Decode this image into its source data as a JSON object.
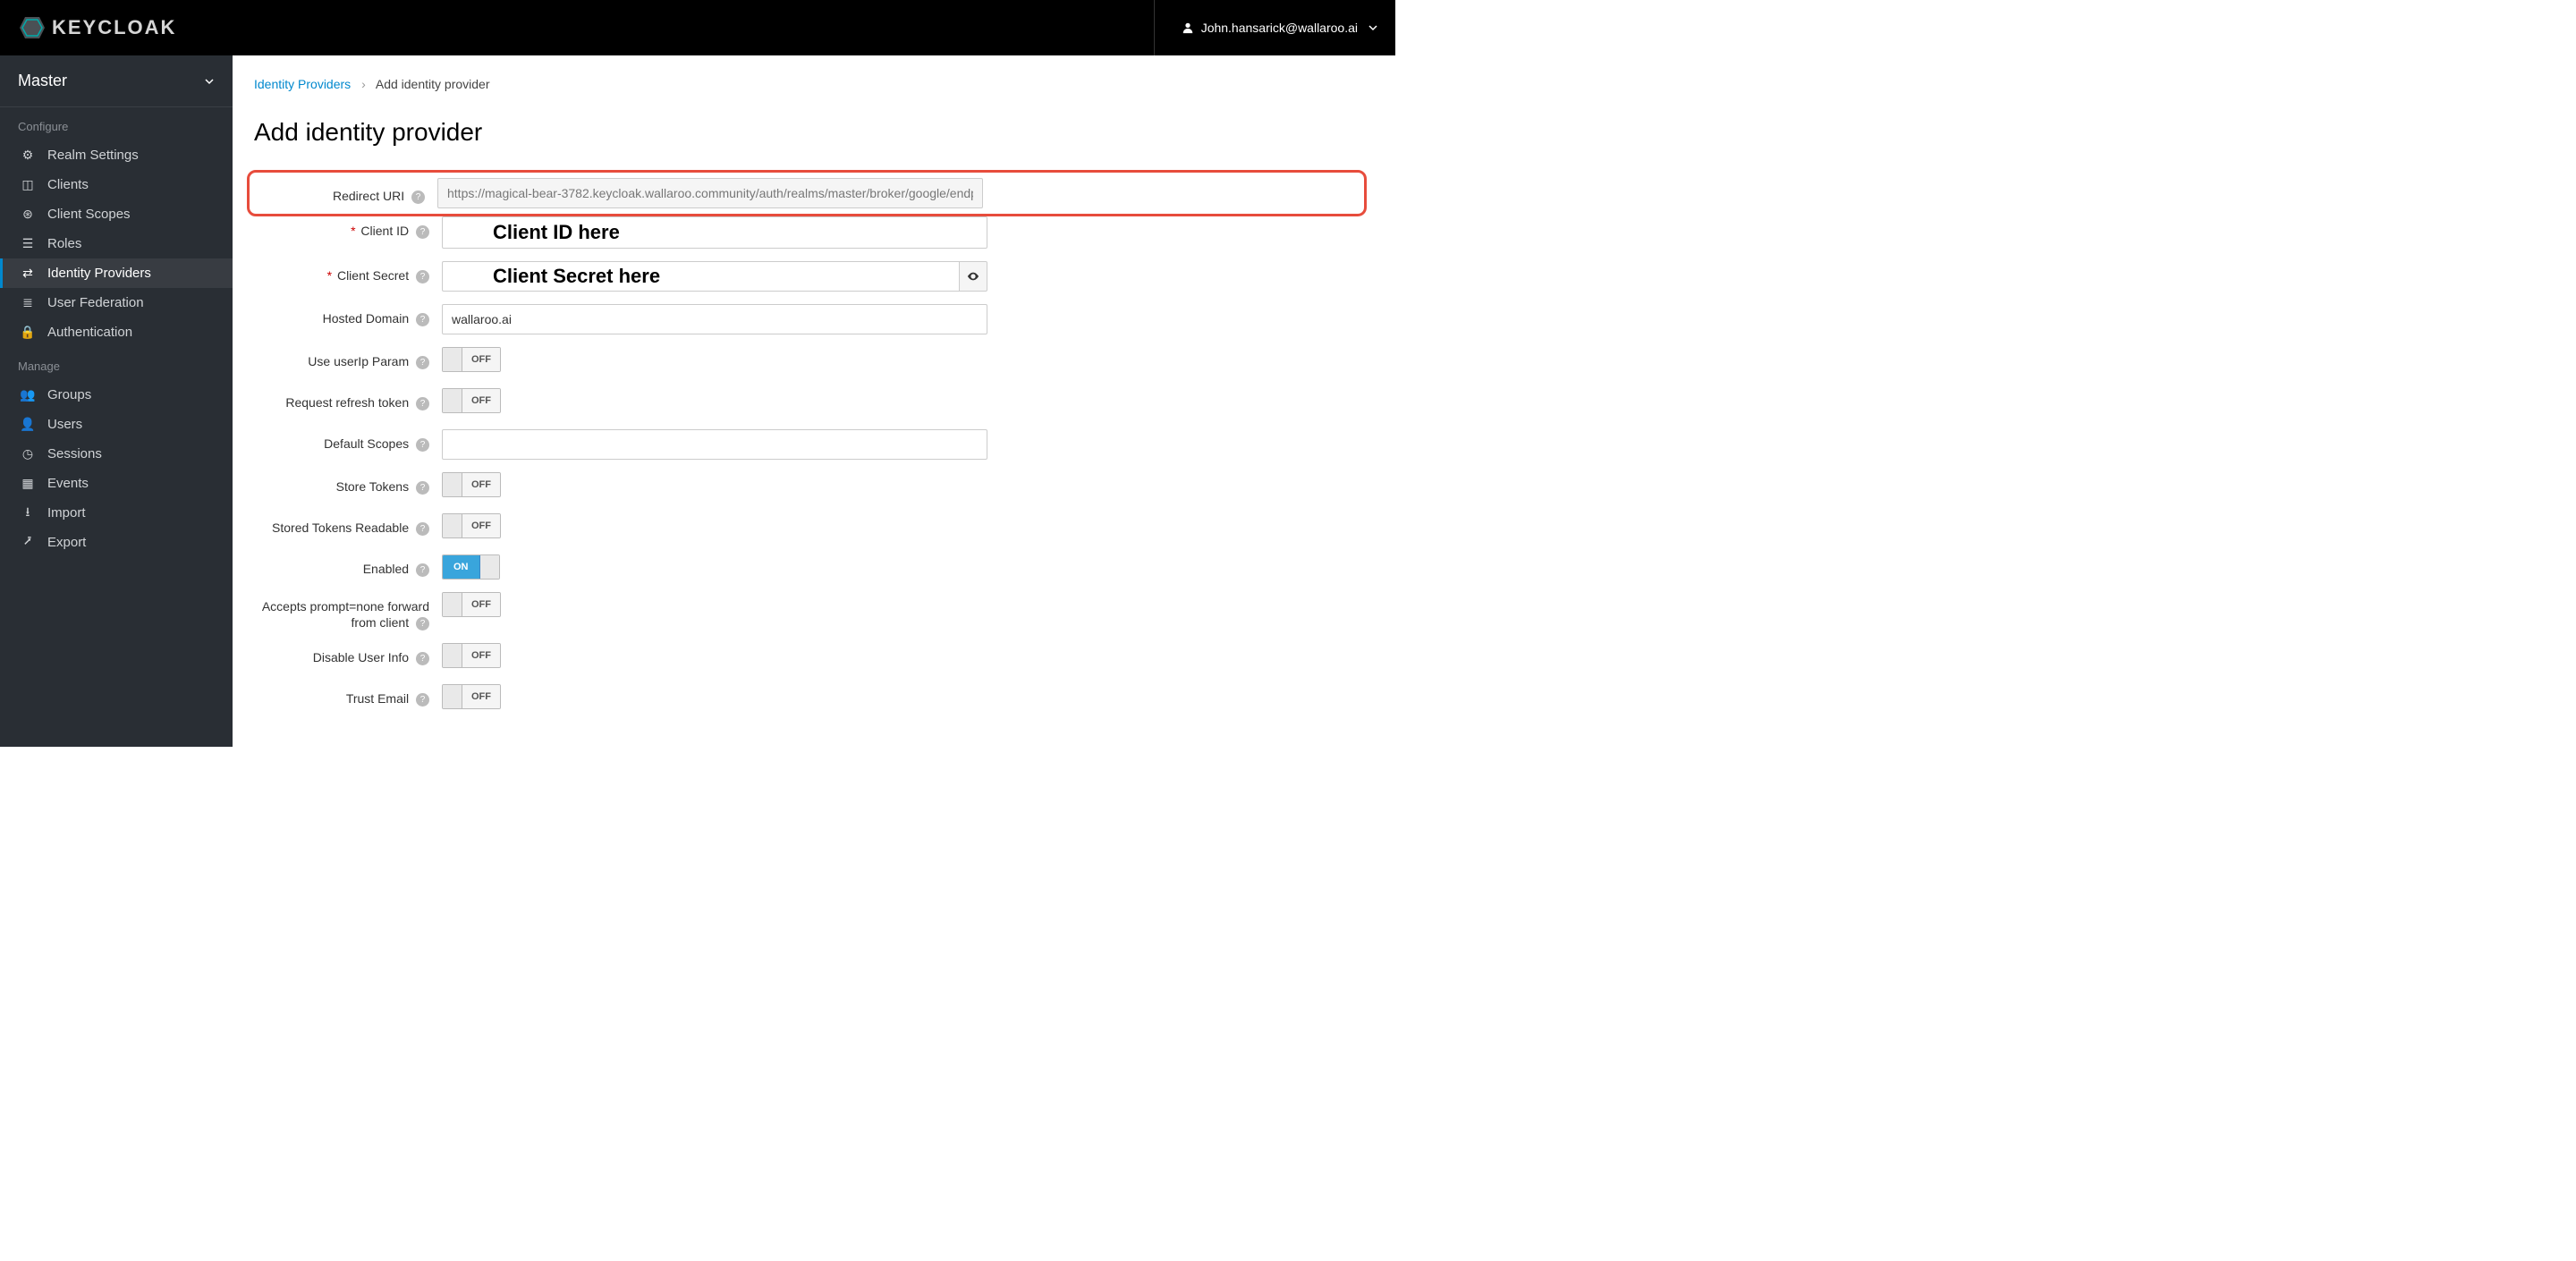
{
  "header": {
    "logo_text": "KEYCLOAK",
    "user_name": "John.hansarick@wallaroo.ai"
  },
  "sidebar": {
    "realm": "Master",
    "sections": [
      {
        "label": "Configure",
        "items": [
          {
            "label": "Realm Settings",
            "icon": "sliders"
          },
          {
            "label": "Clients",
            "icon": "cube"
          },
          {
            "label": "Client Scopes",
            "icon": "rings"
          },
          {
            "label": "Roles",
            "icon": "list"
          },
          {
            "label": "Identity Providers",
            "icon": "exchange",
            "active": true
          },
          {
            "label": "User Federation",
            "icon": "stack"
          },
          {
            "label": "Authentication",
            "icon": "lock"
          }
        ]
      },
      {
        "label": "Manage",
        "items": [
          {
            "label": "Groups",
            "icon": "group"
          },
          {
            "label": "Users",
            "icon": "user"
          },
          {
            "label": "Sessions",
            "icon": "clock"
          },
          {
            "label": "Events",
            "icon": "calendar"
          },
          {
            "label": "Import",
            "icon": "import"
          },
          {
            "label": "Export",
            "icon": "export"
          }
        ]
      }
    ]
  },
  "breadcrumb": {
    "parent": "Identity Providers",
    "current": "Add identity provider"
  },
  "page_title": "Add identity provider",
  "form": {
    "redirect_uri": {
      "label": "Redirect URI",
      "value": "https://magical-bear-3782.keycloak.wallaroo.community/auth/realms/master/broker/google/endp"
    },
    "client_id": {
      "label": "Client ID",
      "annotation": "Client ID here"
    },
    "client_secret": {
      "label": "Client Secret",
      "annotation": "Client Secret here"
    },
    "hosted_domain": {
      "label": "Hosted Domain",
      "value": "wallaroo.ai"
    },
    "use_userip": {
      "label": "Use userIp Param",
      "state": "OFF"
    },
    "request_refresh": {
      "label": "Request refresh token",
      "state": "OFF"
    },
    "default_scopes": {
      "label": "Default Scopes",
      "value": ""
    },
    "store_tokens": {
      "label": "Store Tokens",
      "state": "OFF"
    },
    "stored_readable": {
      "label": "Stored Tokens Readable",
      "state": "OFF"
    },
    "enabled": {
      "label": "Enabled",
      "state": "ON"
    },
    "accepts_prompt": {
      "label": "Accepts prompt=none forward from client",
      "state": "OFF"
    },
    "disable_user_info": {
      "label": "Disable User Info",
      "state": "OFF"
    },
    "trust_email": {
      "label": "Trust Email",
      "state": "OFF"
    }
  }
}
